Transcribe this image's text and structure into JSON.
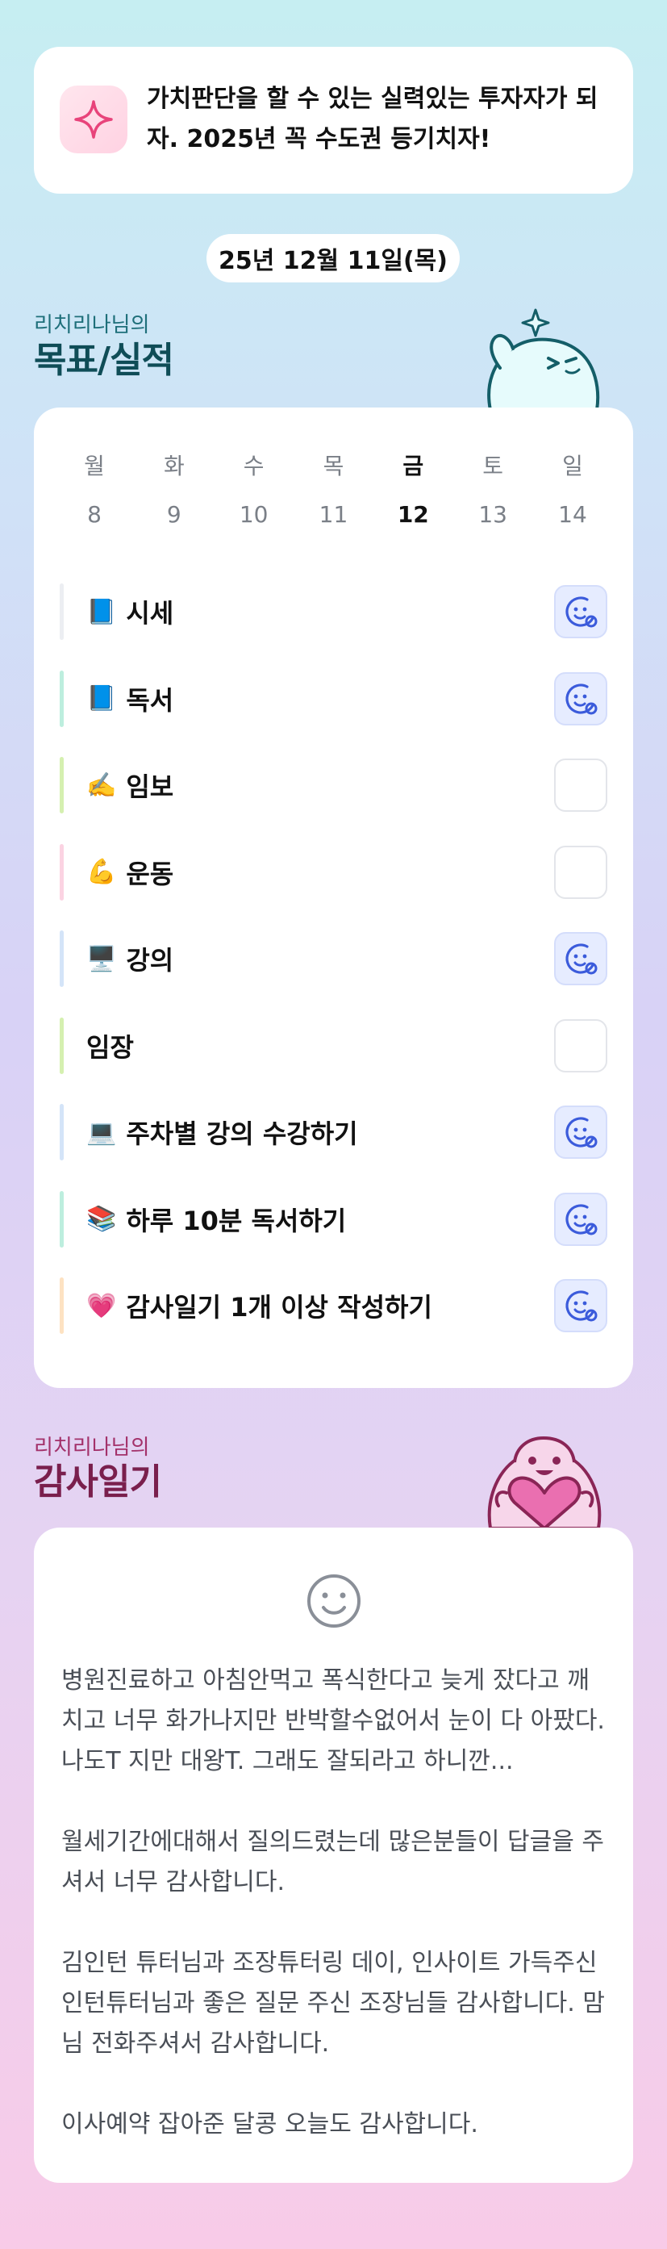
{
  "goal": {
    "icon": "sparkle-icon",
    "text": "가치판단을 할 수 있는 실력있는 투자자가 되자. 2025년 꼭 수도권 등기치자!"
  },
  "date": "25년 12월 11일(목)",
  "goals_section": {
    "subtitle": "리치리나님의",
    "title": "목표/실적"
  },
  "calendar": {
    "days": [
      {
        "name": "월",
        "num": "8"
      },
      {
        "name": "화",
        "num": "9"
      },
      {
        "name": "수",
        "num": "10"
      },
      {
        "name": "목",
        "num": "11"
      },
      {
        "name": "금",
        "num": "12"
      },
      {
        "name": "토",
        "num": "13"
      },
      {
        "name": "일",
        "num": "14"
      }
    ],
    "active_day_index": 4
  },
  "tasks": [
    {
      "emoji": "📘",
      "label": "시세",
      "done": true,
      "bar_color": "#eceef2"
    },
    {
      "emoji": "📘",
      "label": "독서",
      "done": true,
      "bar_color": "#bdeede"
    },
    {
      "emoji": "✍️",
      "label": "임보",
      "done": false,
      "bar_color": "#d5f0b0"
    },
    {
      "emoji": "💪",
      "label": "운동",
      "done": false,
      "bar_color": "#fbd3e2"
    },
    {
      "emoji": "🖥️",
      "label": "강의",
      "done": true,
      "bar_color": "#d4e4f8"
    },
    {
      "emoji": "",
      "label": "임장",
      "done": false,
      "bar_color": "#d5f0b0"
    },
    {
      "emoji": "💻",
      "label": "주차별 강의 수강하기",
      "done": true,
      "bar_color": "#d4e4f8"
    },
    {
      "emoji": "📚",
      "label": "하루 10분 독서하기",
      "done": true,
      "bar_color": "#bdeede"
    },
    {
      "emoji": "💗",
      "label": "감사일기 1개 이상 작성하기",
      "done": true,
      "bar_color": "#fde2c2"
    }
  ],
  "gratitude_section": {
    "subtitle": "리치리나님의",
    "title": "감사일기"
  },
  "gratitude": {
    "mood_icon": "smiley-icon",
    "paragraphs": [
      "병원진료하고 아침안먹고 폭식한다고 늦게 잤다고 깨치고 너무 화가나지만 반박할수없어서 눈이 다 아팠다. 나도T 지만 대왕T. 그래도 잘되라고 하니깐...",
      "월세기간에대해서 질의드렸는데 많은분들이 답글을 주셔서 너무 감사합니다.",
      "김인턴 튜터님과 조장튜터링 데이, 인사이트 가득주신 인턴튜터님과 좋은 질문 주신 조장님들 감사합니다.  맘님 전화주셔서 감사합니다.",
      "이사예약 잡아준 달콩 오늘도 감사합니다."
    ]
  },
  "colors": {
    "accent_blue": "#3b5bdb",
    "done_bg": "#e6ecff",
    "teal_title": "#0f4d57",
    "pink_title": "#7a1f4d"
  }
}
